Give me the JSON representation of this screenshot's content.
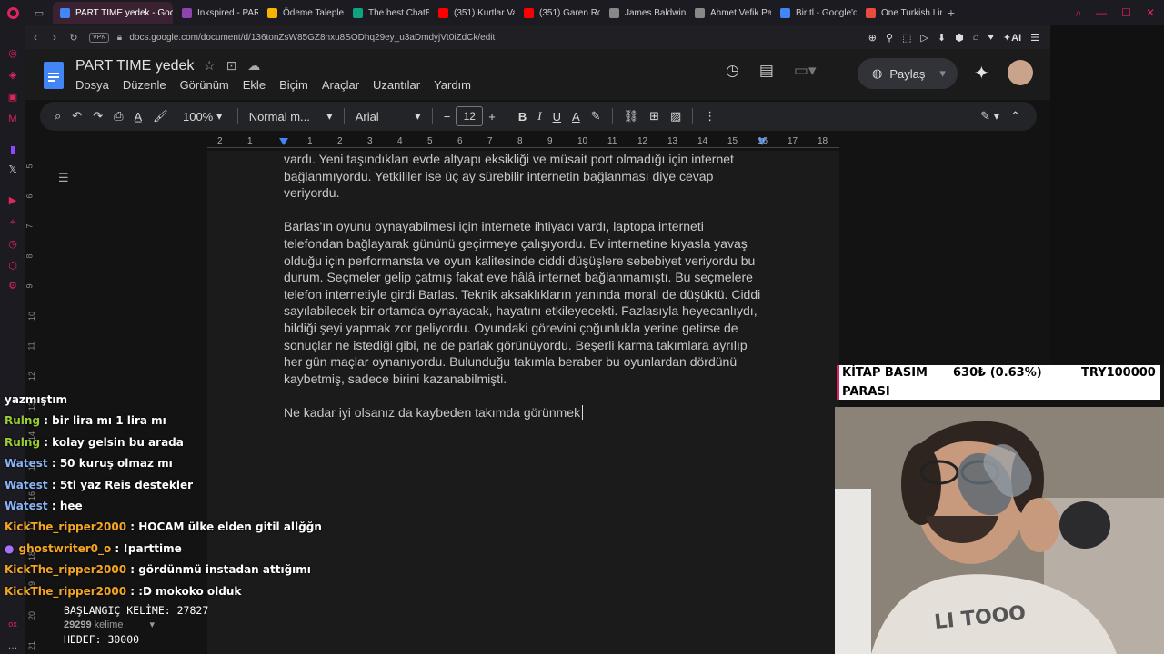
{
  "browser": {
    "tabs": [
      {
        "label": "PART TIME yedek - Googl",
        "active": true,
        "color": "#4285f4"
      },
      {
        "label": "Inkspired - PAR",
        "active": false,
        "color": "#8e44ad"
      },
      {
        "label": "Ödeme Talepler",
        "active": false,
        "color": "#f4b400"
      },
      {
        "label": "The best ChatB",
        "active": false,
        "color": "#10a37f"
      },
      {
        "label": "(351) Kurtlar Va",
        "active": false,
        "color": "#ff0000"
      },
      {
        "label": "(351) Garen Ron",
        "active": false,
        "color": "#ff0000"
      },
      {
        "label": "James Baldwin",
        "active": false,
        "color": "#888888"
      },
      {
        "label": "Ahmet Vefik Pa",
        "active": false,
        "color": "#888888"
      },
      {
        "label": "Bir tl - Google'd",
        "active": false,
        "color": "#4285f4"
      },
      {
        "label": "One Turkish Lira",
        "active": false,
        "color": "#e74c3c"
      }
    ],
    "url": "docs.google.com/document/d/136tonZsW85GZ8nxu8SODhq29ey_u3aDmdyjVt0iZdCk/edit",
    "vpn_label": "VPN",
    "ai_label": "AI"
  },
  "doc": {
    "title": "PART TIME  yedek",
    "menus": [
      "Dosya",
      "Düzenle",
      "Görünüm",
      "Ekle",
      "Biçim",
      "Araçlar",
      "Uzantılar",
      "Yardım"
    ],
    "share_label": "Paylaş",
    "toolbar": {
      "zoom": "100%",
      "style": "Normal m...",
      "font": "Arial",
      "font_size": "12"
    },
    "ruler_marks": [
      "2",
      "1",
      "",
      "1",
      "2",
      "3",
      "4",
      "5",
      "6",
      "7",
      "8",
      "9",
      "10",
      "11",
      "12",
      "13",
      "14",
      "15",
      "16",
      "17",
      "18"
    ],
    "vruler_marks": [
      "5",
      "6",
      "7",
      "8",
      "9",
      "10",
      "11",
      "12",
      "13",
      "14",
      "15",
      "16",
      "17",
      "18",
      "19",
      "20",
      "21"
    ],
    "paragraphs": [
      "vardı. Yeni taşındıkları evde altyapı eksikliği ve müsait port olmadığı için internet bağlanmıyordu. Yetkililer ise üç ay sürebilir internetin bağlanması diye cevap veriyordu.",
      "Barlas'ın oyunu oynayabilmesi için internete ihtiyacı vardı, laptopa interneti telefondan bağlayarak gününü geçirmeye çalışıyordu. Ev internetine kıyasla yavaş olduğu için performansta ve oyun kalitesinde ciddi düşüşlere sebebiyet veriyordu bu durum. Seçmeler gelip çatmış fakat eve hâlâ internet bağlanmamıştı. Bu seçmelere telefon internetiyle girdi Barlas. Teknik aksaklıkların yanında morali de düşüktü. Ciddi sayılabilecek bir ortamda oynayacak, hayatını etkileyecekti. Fazlasıyla heyecanlıydı, bildiği şeyi yapmak zor geliyordu. Oyundaki görevini çoğunlukla yerine getirse de sonuçlar ne istediği gibi, ne de parlak görünüyordu. Beşerli karma takımlara ayrılıp her gün maçlar oynanıyordu. Bulunduğu takımla beraber bu oyunlardan dördünü kaybetmiş, sadece birini kazanabilmişti.",
      "Ne kadar iyi olsanız da kaybeden takımda görünmek"
    ],
    "word_count_value": "29299",
    "word_count_label": "kelime"
  },
  "overlay": {
    "chat": [
      {
        "user": "",
        "message": "yazmıştım",
        "color": "#ffffff"
      },
      {
        "user": "Rulng",
        "message": " : bir lira mı 1 lira mı",
        "color": "#9acd32"
      },
      {
        "user": "Rulng",
        "message": " : kolay gelsin bu arada",
        "color": "#9acd32"
      },
      {
        "user": "Watest",
        "message": " : 50 kuruş olmaz mı",
        "color": "#8ab4f8"
      },
      {
        "user": "Watest",
        "message": " : 5tl yaz Reis destekler",
        "color": "#8ab4f8"
      },
      {
        "user": "Watest",
        "message": " : hee",
        "color": "#8ab4f8"
      },
      {
        "user": "KickThe_ripper2000",
        "message": " : HOCAM ülke elden gitil allğğn",
        "color": "#f5a623"
      },
      {
        "user": "ghostwriter0_o",
        "message": " : !parttime",
        "color": "#f5a623"
      },
      {
        "user": "KickThe_ripper2000",
        "message": " : gördünmü instadan attığımı",
        "color": "#f5a623"
      },
      {
        "user": "KickThe_ripper2000",
        "message": " : :D mokoko olduk",
        "color": "#f5a623"
      }
    ],
    "start_words": "BAŞLANGIÇ KELİME: 27827",
    "target_words": "HEDEF: 30000",
    "ticker": {
      "name": "KİTAP BASIM",
      "name2": "PARASI",
      "amount": "630₺ (0.63%)",
      "goal": "TRY100000"
    }
  }
}
